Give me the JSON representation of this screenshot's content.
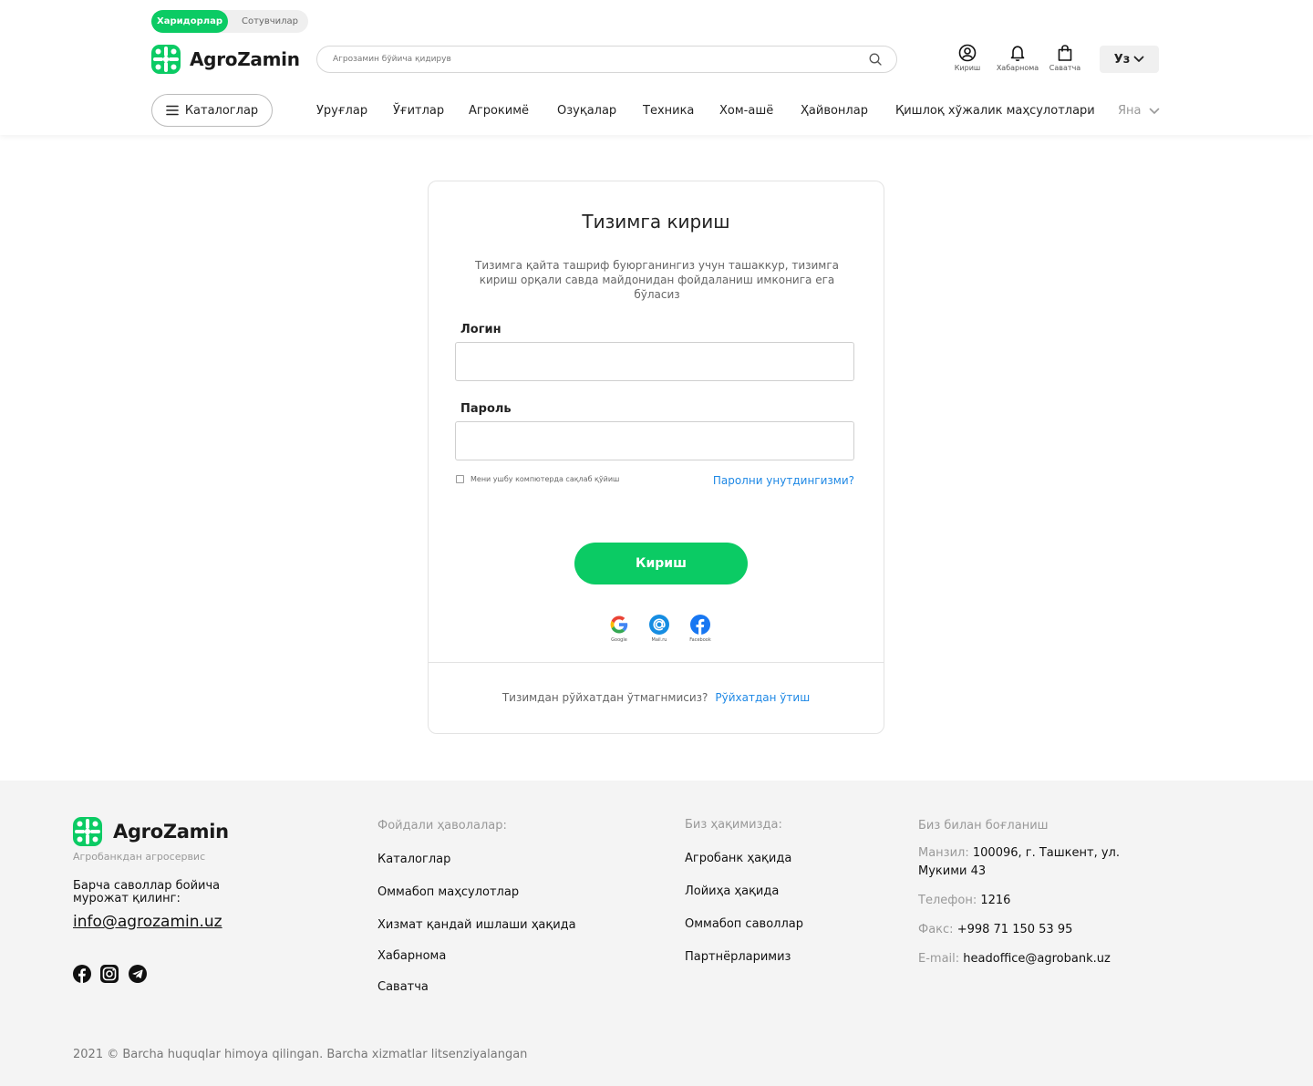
{
  "brand": {
    "name": "AgroZamin",
    "green": "#0bcb64"
  },
  "header": {
    "role_toggle": {
      "active": "Харидорлар",
      "inactive": "Сотувчилар"
    },
    "search_placeholder": "Агрозамин бўйича қидирув",
    "icons": [
      {
        "icon": "user-circle-icon",
        "label": "Кириш"
      },
      {
        "icon": "bell-icon",
        "label": "Хабарнома"
      },
      {
        "icon": "shopping-bag-icon",
        "label": "Саватча"
      }
    ],
    "language": "Уз",
    "catalog_button": "Каталоглар",
    "nav": [
      "Уруғлар",
      "Ўғитлар",
      "Агрокимё",
      "Озуқалар",
      "Техника",
      "Хом-ашё",
      "Ҳайвонлар",
      "Қишлоқ хўжалик маҳсулотлари"
    ],
    "nav_more": "Яна"
  },
  "login": {
    "title": "Тизимга кириш",
    "description": "Тизимга қайта ташриф буюрганингиз учун ташаккур, тизимга кириш орқали савда майдонидан фойдаланиш имконига ега бўласиз",
    "login_label": "Логин",
    "login_value": "",
    "password_label": "Пароль",
    "password_value": "",
    "remember_label": "Мени ушбу компютерда сақлаб қўйиш",
    "remember_checked": false,
    "forgot_link": "Паролни унутдингизми?",
    "submit": "Кириш",
    "social": [
      {
        "icon": "google-icon",
        "label": "Google"
      },
      {
        "icon": "mail-ru-icon",
        "label": "Mail.ru"
      },
      {
        "icon": "facebook-icon",
        "label": "Facebook"
      }
    ],
    "register_question": "Тизимдан рўйхатдан ўтмагнмисиз?",
    "register_link": "Рўйхатдан ўтиш"
  },
  "footer": {
    "tagline": "Агробанкдан агросервис",
    "ask": "Барча саволлар бойича мурожат қилинг:",
    "email": "info@agrozamin.uz",
    "social_icons": [
      "facebook-icon",
      "instagram-icon",
      "telegram-icon"
    ],
    "useful_links_title": "Фойдали ҳаволалар:",
    "useful_links": [
      "Каталоглар",
      "Оммабоп маҳсулотлар",
      "Хизмат қандай ишлаши ҳақида",
      "Хабарнома",
      "Саватча"
    ],
    "about_title": "Биз ҳақимизда:",
    "about_links": [
      "Агробанк ҳақида",
      "Лойиҳа ҳақида",
      "Оммабоп саволлар",
      "Партнёрларимиз"
    ],
    "contact_title": "Биз билан боғланиш",
    "contacts": {
      "address_key": "Манзил:",
      "address_value": "100096, г. Ташкент, ул. Мукими 43",
      "phone_key": "Телефон:",
      "phone_value": "1216",
      "fax_key": "Факс:",
      "fax_value": "+998 71 150 53 95",
      "email_key": "E-mail:",
      "email_value": "headoffice@agrobank.uz"
    },
    "copyright": "2021 © Barcha huquqlar himoya qilingan. Barcha xizmatlar litsenziyalangan"
  }
}
